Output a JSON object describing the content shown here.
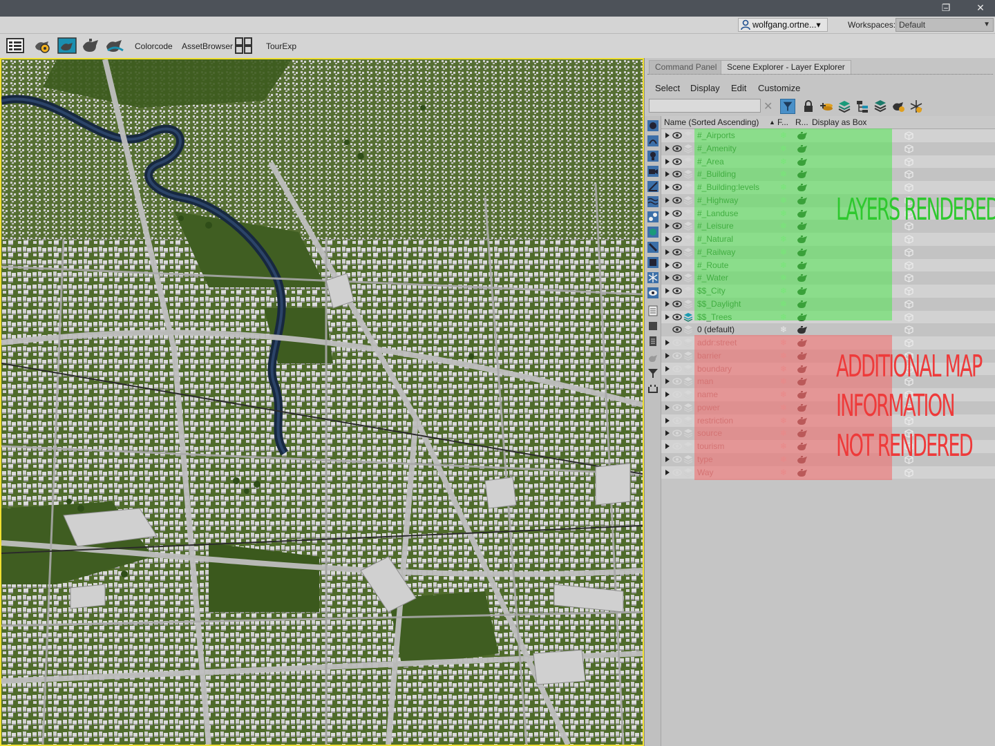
{
  "window": {
    "minimize_glyph": "–",
    "restore_glyph": "❐",
    "close_glyph": "✕"
  },
  "account": {
    "user": "wolfgang.ortne...▾",
    "workspaces_label": "Workspaces:",
    "workspace_value": "Default"
  },
  "toolbar": {
    "colorcode": "Colorcode",
    "assetbrowser": "AssetBrowser",
    "tourexp": "TourExp"
  },
  "panel": {
    "tab_command": "Command Panel",
    "tab_scene": "Scene Explorer - Layer Explorer",
    "menu": [
      "Select",
      "Display",
      "Edit",
      "Customize"
    ],
    "search_value": "",
    "clear_glyph": "✕"
  },
  "list": {
    "col_name": "Name (Sorted Ascending)",
    "col_sort_glyph": "▲",
    "col_f": "F...",
    "col_r": "R...",
    "col_box": "Display as Box",
    "rows": [
      {
        "name": "#_Airports",
        "state": "rendered"
      },
      {
        "name": "#_Amenity",
        "state": "rendered"
      },
      {
        "name": "#_Area",
        "state": "rendered"
      },
      {
        "name": "#_Building",
        "state": "rendered"
      },
      {
        "name": "#_Building:levels",
        "state": "rendered"
      },
      {
        "name": "#_Highway",
        "state": "rendered"
      },
      {
        "name": "#_Landuse",
        "state": "rendered"
      },
      {
        "name": "#_Leisure",
        "state": "rendered"
      },
      {
        "name": "#_Natural",
        "state": "rendered"
      },
      {
        "name": "#_Railway",
        "state": "rendered"
      },
      {
        "name": "#_Route",
        "state": "rendered"
      },
      {
        "name": "#_Water",
        "state": "rendered"
      },
      {
        "name": "$$_City",
        "state": "rendered"
      },
      {
        "name": "$$_Daylight",
        "state": "rendered"
      },
      {
        "name": "$$_Trees",
        "state": "rendered"
      },
      {
        "name": "0 (default)",
        "state": "default"
      },
      {
        "name": "addr:street",
        "state": "hidden"
      },
      {
        "name": "barrier",
        "state": "hidden"
      },
      {
        "name": "boundary",
        "state": "hidden"
      },
      {
        "name": "man",
        "state": "hidden"
      },
      {
        "name": "name",
        "state": "hidden"
      },
      {
        "name": "power",
        "state": "hidden"
      },
      {
        "name": "restriction",
        "state": "hidden"
      },
      {
        "name": "source",
        "state": "hidden"
      },
      {
        "name": "tourism",
        "state": "hidden"
      },
      {
        "name": "type",
        "state": "hidden"
      },
      {
        "name": "Way",
        "state": "hidden"
      }
    ]
  },
  "annotations": {
    "rendered": "LAYERS RENDERED",
    "not_rendered_1": "ADDITIONAL MAP",
    "not_rendered_2": "INFORMATION",
    "not_rendered_3": "NOT RENDERED"
  },
  "colors": {
    "rendered_overlay": "#50e650",
    "not_rendered_overlay": "#f06e6e",
    "viewport_border": "#f0e030",
    "ground": "#4e6a2a",
    "buildings": "#d6d6d6",
    "river": "#1c2f4a"
  }
}
